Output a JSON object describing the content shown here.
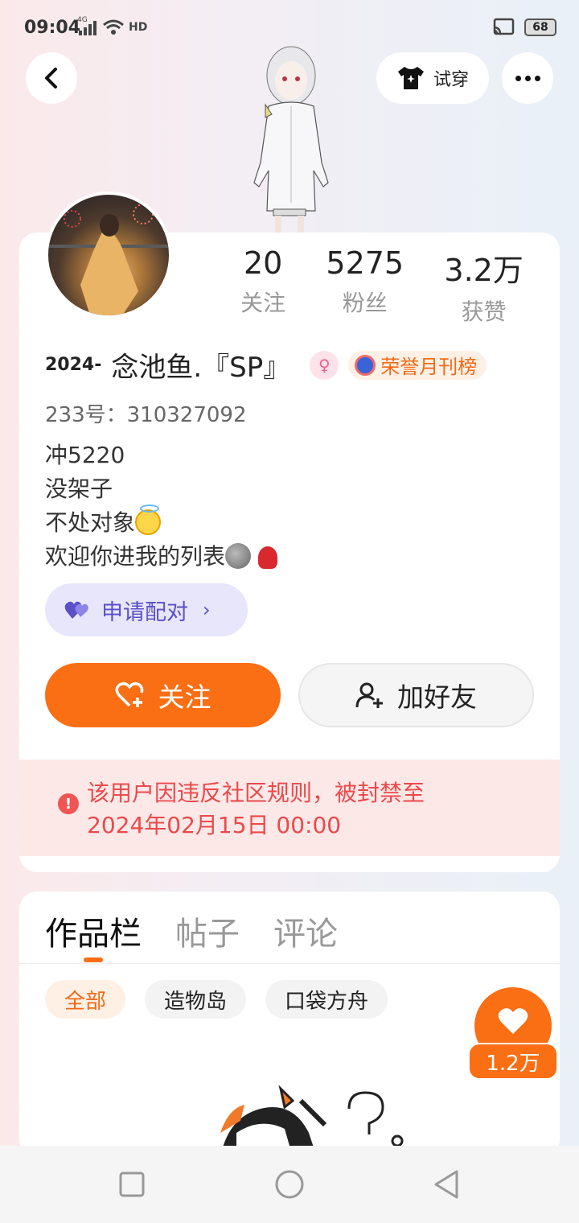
{
  "status_bar": {
    "time": "09:04",
    "network": "4G",
    "hd": "HD",
    "battery": "68"
  },
  "nav": {
    "try_on_label": "试穿"
  },
  "profile": {
    "stats": [
      {
        "value": "20",
        "label": "关注"
      },
      {
        "value": "5275",
        "label": "粉丝"
      },
      {
        "value": "3.2万",
        "label": "获赞"
      }
    ],
    "name_prefix": "2024-",
    "name": "念池鱼.『SP』",
    "gender_symbol": "♀",
    "honor_badge": "荣誉月刊榜",
    "uid": "233号：310327092",
    "bio_lines": [
      "冲5220",
      "没架子",
      "不处对象",
      "欢迎你进我的列表"
    ],
    "pair_label": "申请配对",
    "follow_label": "关注",
    "add_friend_label": "加好友",
    "ban_line1": "该用户因违反社区规则，被封禁至",
    "ban_line2": "2024年02月15日 00:00"
  },
  "works": {
    "tabs": [
      "作品栏",
      "帖子",
      "评论"
    ],
    "filters": [
      "全部",
      "造物岛",
      "口袋方舟"
    ]
  },
  "like_fab": {
    "count": "1.2万"
  },
  "colors": {
    "accent": "#fa6e14",
    "ban_text": "#ea4a4a",
    "pair": "#5a50c8"
  }
}
